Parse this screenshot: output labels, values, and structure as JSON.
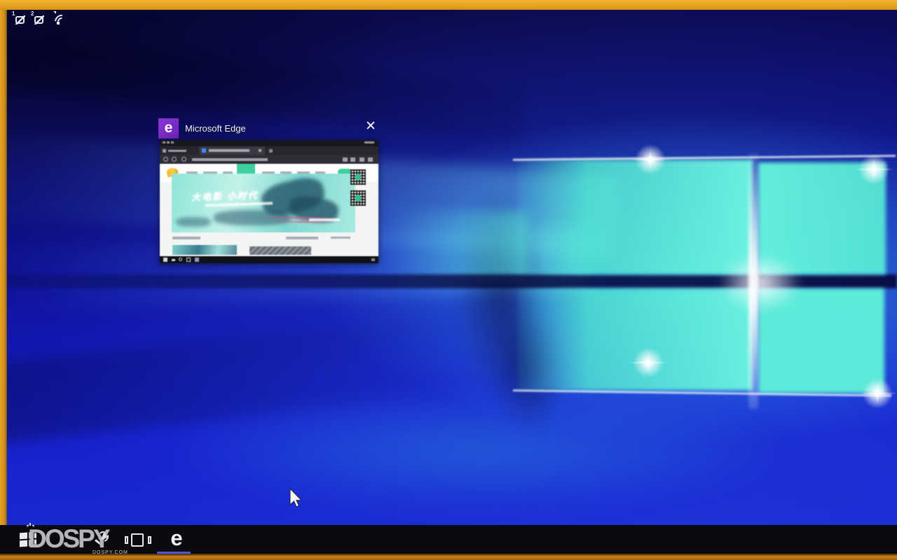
{
  "osd": {
    "source_badge_1": "1",
    "source_badge_2": "2",
    "icons": [
      "device-1-no-signal",
      "device-2-no-signal",
      "wifi"
    ]
  },
  "task_view": {
    "app": {
      "title": "Microsoft Edge",
      "close_glyph": "✕",
      "logo_glyph": "e"
    },
    "thumbnail": {
      "hero_title": "大电影 小时代",
      "mini_taskbar_icons": [
        "start",
        "back",
        "search",
        "camera",
        "edge"
      ]
    }
  },
  "taskbar": {
    "edge_glyph": "e",
    "buttons": [
      "start",
      "search",
      "task-view",
      "edge"
    ],
    "active_app": "edge",
    "watermark": {
      "text": "DOSPY",
      "subtext": "DOSPY.COM"
    }
  },
  "colors": {
    "bezel_yellow": "#e8a31f",
    "taskbar_bg": "#0a0a11",
    "active_underline": "#5a52d5",
    "edge_tile_purple": "#7a2fc8",
    "wallpaper_cyan": "#52ecd2",
    "wallpaper_blue": "#1b2dd8",
    "site_teal": "#3ecfa0"
  }
}
